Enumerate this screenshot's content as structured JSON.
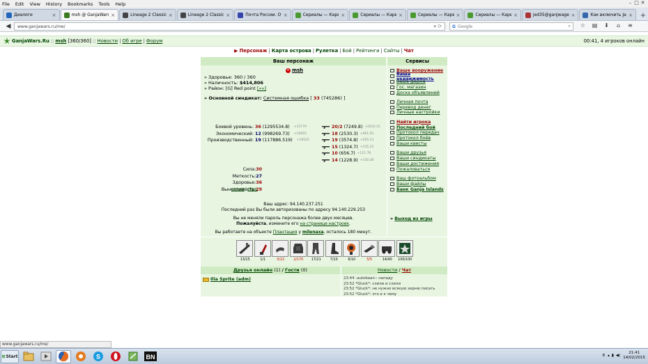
{
  "menu": [
    "File",
    "Edit",
    "View",
    "History",
    "Bookmarks",
    "Tools",
    "Help"
  ],
  "tabs": [
    {
      "title": "Диалоги",
      "color": "#2266bb"
    },
    {
      "title": "msh @ GanjaWars.Ru",
      "color": "#3a7a20",
      "active": true
    },
    {
      "title": "Lineage 2 Classic —",
      "color": "#444"
    },
    {
      "title": "Lineage 2 Classic - 6...",
      "color": "#444"
    },
    {
      "title": "Почта России. Отсл...",
      "color": "#3344aa"
    },
    {
      "title": "Сериалы — Карель...",
      "color": "#4a9a30"
    },
    {
      "title": "Сериалы — Карель...",
      "color": "#4a9a30"
    },
    {
      "title": "Сериалы — Карель...",
      "color": "#4a9a30"
    },
    {
      "title": "Сериалы — Карель...",
      "color": "#4a9a30"
    },
    {
      "title": "jed35@ganjwagen...",
      "color": "#aa3333"
    },
    {
      "title": "Как включить Java...",
      "color": "#3366aa"
    }
  ],
  "url": "www.ganjawars.ru/me/",
  "search_placeholder": "Google",
  "site": {
    "logo": "GanjaWars.Ru",
    "user": "msh",
    "hp": "[360/360]",
    "links": [
      "Новости",
      "Об игре",
      "Форум"
    ],
    "online": "00:41, 4 игроков онлайн"
  },
  "nav": [
    {
      "label": "Персонаж",
      "cur": true
    },
    {
      "label": "Карта острова"
    },
    {
      "label": "Рулетка"
    },
    {
      "label": "Бой",
      "plain": true
    },
    {
      "label": "Рейтинги",
      "plain": true
    },
    {
      "label": "Сайты",
      "plain": true
    },
    {
      "label": "Чат",
      "red": true
    }
  ],
  "char": {
    "header": "Ваш персонаж",
    "name": "msh",
    "health_label": "» Здоровье: ",
    "health": "360 / 360",
    "cash_label": "» Наличность: ",
    "cash": "$414,806",
    "area_label": "» Район: ",
    "area": "[G] Red point",
    "area_link": "[»»]",
    "syn_label": "» Основной синдикат: ",
    "syn_name": "Системная ошибка",
    "syn_open": "[",
    "syn_num": "33",
    "syn_pts": "(745286)",
    "syn_close": "]"
  },
  "levels": [
    {
      "label": "Боевой уровень:",
      "val": "36",
      "extra": "(1295534.8)",
      "small": "+33779"
    },
    {
      "label": "Экономический:",
      "val": "12",
      "extra": "(998269.73)",
      "small": "+10693",
      "blue": true
    },
    {
      "label": "Производственный:",
      "val": "19",
      "extra": "(117886.519)",
      "small": "+19525",
      "blue": true
    }
  ],
  "attrs": [
    {
      "label": "Сила:",
      "val": "30"
    },
    {
      "label": "Меткость:",
      "val": "27",
      "blue": true
    },
    {
      "label": "Здоровье:",
      "val": "36"
    },
    {
      "label": "Выносливость:",
      "val": "29"
    }
  ],
  "reset_links": [
    "навыки",
    "сброс"
  ],
  "skills": [
    {
      "val": "20/2",
      "extra": "(7249.8)",
      "small": "+2010.15"
    },
    {
      "val": "18",
      "extra": "(2530.3)",
      "small": "+961.93"
    },
    {
      "val": "19",
      "extra": "(3574.8)",
      "small": "+505.13"
    },
    {
      "val": "15",
      "extra": "(1324.7)",
      "small": "+135.15"
    },
    {
      "val": "10",
      "extra": "(656.7)",
      "small": "+111.76"
    },
    {
      "val": "14",
      "extra": "(1228.9)",
      "small": "+150.38"
    }
  ],
  "ip": {
    "line1": "Ваш адрес: 94.140.237.251",
    "line2": "Последний раз Вы были авторизованы по адресу 94.140.229.253"
  },
  "pwd": {
    "line1": "Вы не меняли пароль персонажа более двух месяцев.",
    "please": "Пожалуйста",
    "mid": ", измените его ",
    "link": "на странице настроек",
    "end": "."
  },
  "work": {
    "pre": "Вы работаете на объекте ",
    "obj": "Плантация",
    "mid": " у ",
    "owner": "milenaxa",
    "post": ", осталось 180 минут."
  },
  "services": {
    "header": "Сервисы",
    "groups": [
      [
        {
          "label": "Ваше вооружение",
          "style": "red"
        },
        {
          "label": "Ваша недвижимость",
          "style": "blue"
        },
        {
          "label": "Ваша ферма"
        },
        {
          "label": "Гос. магазин"
        },
        {
          "label": "Доска объявлений"
        }
      ],
      [
        {
          "label": "Личная почта"
        },
        {
          "label": "Перевод денег"
        },
        {
          "label": "Личные настройки"
        }
      ],
      [
        {
          "label": "Найти игрока",
          "style": "red"
        },
        {
          "label": "Последний бой",
          "style": "strong"
        },
        {
          "label": "Протокол передач"
        },
        {
          "label": "Протокол боёв"
        },
        {
          "label": "Ваши квесты"
        }
      ],
      [
        {
          "label": "Ваши друзья"
        },
        {
          "label": "Ваши синдикаты"
        },
        {
          "label": "Ваши достижения"
        },
        {
          "label": "Пожаловаться"
        }
      ],
      [
        {
          "label": "Ваш фотоальбом"
        },
        {
          "label": "Ваши файлы"
        },
        {
          "label": "Банк Ganja Islands",
          "style": "strong"
        }
      ]
    ],
    "exit": "Выход из игры"
  },
  "items": [
    "13/15",
    "1/1",
    "5/22",
    "2/170",
    "17/21",
    "7/10",
    "6/10",
    "5/5",
    "14/40",
    "100/100"
  ],
  "friends": {
    "title": "Друзья онлайн",
    "count": "(1)",
    "slash": "/",
    "guests": "Гости",
    "gcount": "(0)",
    "list": [
      "Ilia Sprite (adm)"
    ]
  },
  "news": {
    "news": "Новости",
    "slash": "/",
    "chat": "Чат",
    "msgs": [
      "23:44 -autobaan-: нападу",
      "23:52 *Gluck*: слили и слили",
      "23:52 *Gluck*: не нужно всякую херню писать",
      "23:52 *Gluck*: это е к чему"
    ]
  },
  "statusbar": "www.ganjawars.ru/me/",
  "tray": {
    "lang": "8",
    "time": "21:41",
    "date": "14/02/2015"
  }
}
